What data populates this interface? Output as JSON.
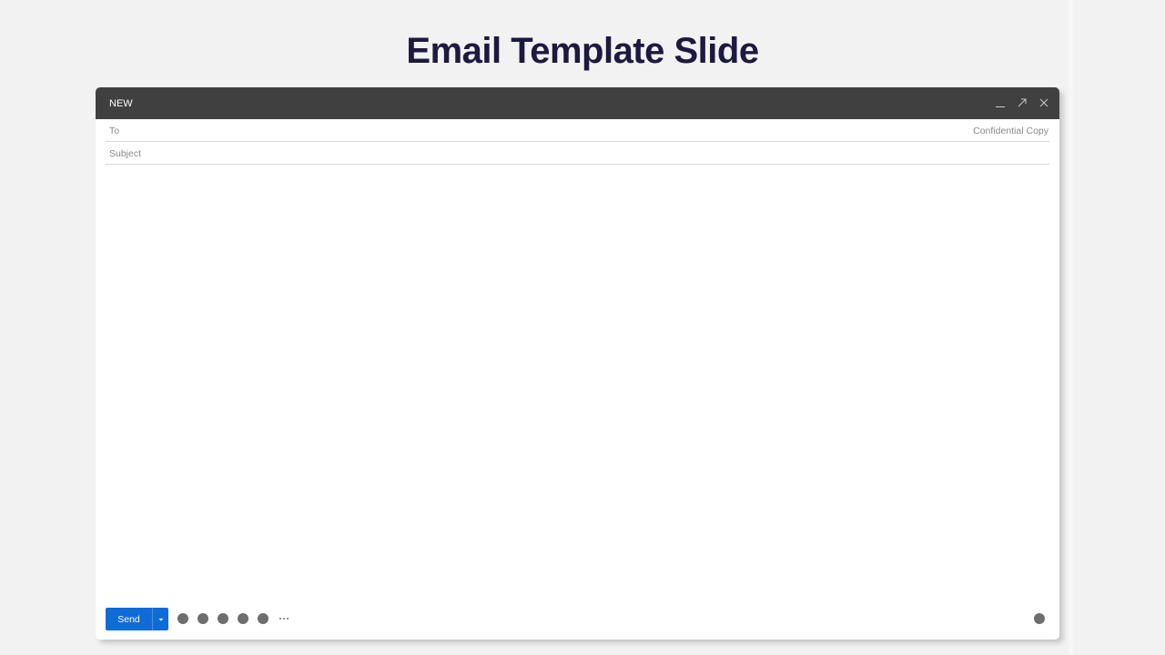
{
  "slide": {
    "title": "Email Template Slide"
  },
  "window": {
    "title": "NEW"
  },
  "fields": {
    "to_label": "To",
    "cc_label": "Confidential Copy",
    "subject_label": "Subject",
    "body": ""
  },
  "toolbar": {
    "send_label": "Send",
    "more_label": "···"
  },
  "colors": {
    "titlebar": "#404040",
    "send_button": "#0f6cd7",
    "slide_title": "#1e1940",
    "icon_gray": "#6e6e6e"
  }
}
